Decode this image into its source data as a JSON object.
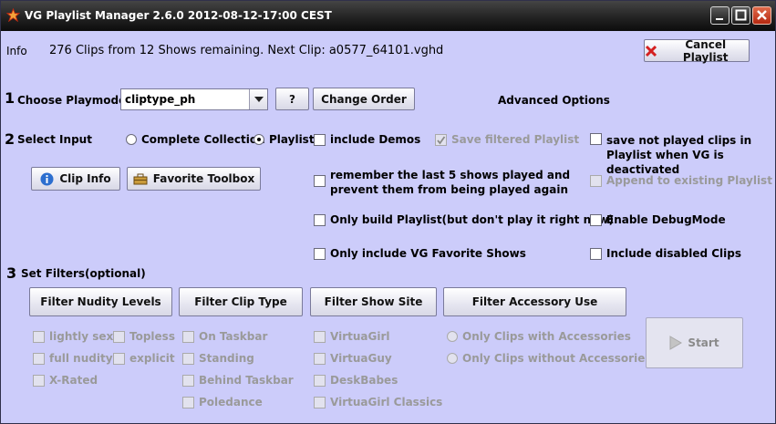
{
  "window": {
    "title": "VG Playlist Manager 2.6.0 2012-08-12-17:00 CEST",
    "controls": [
      "minimize",
      "maximize",
      "close"
    ]
  },
  "info": {
    "label": "Info",
    "text": "276 Clips from 12 Shows remaining. Next Clip: a0577_64101.vghd",
    "cancel_button": "Cancel Playlist"
  },
  "playmode": {
    "number": "1",
    "label": "Choose Playmode",
    "selected": "cliptype_ph",
    "help_button": "?",
    "change_order_button": "Change Order",
    "advanced_label": "Advanced Options"
  },
  "input": {
    "number": "2",
    "label": "Select Input",
    "radio_collection": "Complete Collection",
    "radio_playlist": "Playlist",
    "selected": "Playlist",
    "clip_info_button": "Clip Info",
    "favorite_toolbox_button": "Favorite Toolbox"
  },
  "options": {
    "include_demos": "include Demos",
    "save_filtered": "Save filtered Playlist",
    "save_not_played": "save not played clips in Playlist when VG is deactivated",
    "remember_last_5": "remember the last 5 shows played and prevent them from being played again",
    "append_existing": "Append to existing Playlist",
    "only_build": "Only build Playlist(but don't play it right now)",
    "enable_debug": "Enable DebugMode",
    "only_favorites": "Only include VG Favorite Shows",
    "include_disabled": "Include disabled Clips"
  },
  "filters": {
    "number": "3",
    "label": "Set Filters(optional)",
    "nudity_button": "Filter Nudity Levels",
    "cliptype_button": "Filter Clip Type",
    "showsite_button": "Filter Show Site",
    "accessory_button": "Filter Accessory Use",
    "nudity": [
      "lightly sexy",
      "Topless",
      "full nudity",
      "explicit",
      "X-Rated"
    ],
    "cliptype": [
      "On Taskbar",
      "Standing",
      "Behind Taskbar",
      "Poledance"
    ],
    "showsite": [
      "VirtuaGirl",
      "VirtuaGuy",
      "DeskBabes",
      "VirtuaGirl Classics"
    ],
    "accessory": [
      "Only Clips with Accessories",
      "Only Clips without Accessories"
    ],
    "start_button": "Start"
  },
  "colors": {
    "background": "#ccccfa",
    "disabled_text": "#9a9a9a",
    "cancel_icon": "#d42020",
    "info_icon": "#2c6ecf"
  }
}
